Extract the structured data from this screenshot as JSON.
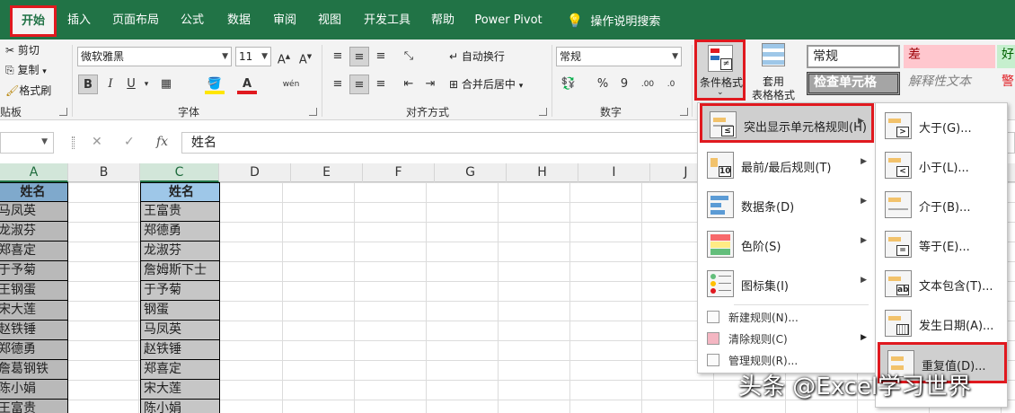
{
  "tabs": [
    "开始",
    "插入",
    "页面布局",
    "公式",
    "数据",
    "审阅",
    "视图",
    "开发工具",
    "帮助",
    "Power Pivot",
    "操作说明搜索"
  ],
  "clipboard": {
    "cut": "剪切",
    "copy": "复制",
    "format_painter": "格式刷",
    "group": "贴板"
  },
  "font": {
    "name": "微软雅黑",
    "size": "11",
    "group": "字体",
    "bold": "B",
    "italic": "I",
    "underline": "U",
    "phonetic": "wén"
  },
  "alignment": {
    "wrap": "自动换行",
    "merge": "合并后居中",
    "group": "对齐方式"
  },
  "number": {
    "format": "常规",
    "group": "数字",
    "percent": "%",
    "comma": "9"
  },
  "styles": {
    "conditional_format": "条件格式",
    "table_format_1": "套用",
    "table_format_2": "表格格式",
    "normal": "常规",
    "bad": "差",
    "good": "好",
    "check_cell": "检查单元格",
    "explanatory": "解释性文本",
    "warning": "警"
  },
  "formula_bar": {
    "fx": "fx",
    "cancel": "✕",
    "enter": "✓",
    "content": "姓名"
  },
  "columns": [
    "A",
    "B",
    "C",
    "D",
    "E",
    "F",
    "G",
    "H",
    "I",
    "J"
  ],
  "col_a": [
    "姓名",
    "马凤英",
    "龙淑芬",
    "郑喜定",
    "于予菊",
    "王钢蛋",
    "宋大莲",
    "赵铁锤",
    "郑德勇",
    "詹葛钢铁",
    "陈小娟",
    "王富贵"
  ],
  "col_c": [
    "姓名",
    "王富贵",
    "郑德勇",
    "龙淑芬",
    "詹姆斯下士",
    "于予菊",
    "钢蛋",
    "马凤英",
    "赵铁锤",
    "郑喜定",
    "宋大莲",
    "陈小娟"
  ],
  "menu": {
    "highlight_rules": "突出显示单元格规则(H)",
    "top_bottom": "最前/最后规则(T)",
    "data_bars": "数据条(D)",
    "color_scales": "色阶(S)",
    "icon_sets": "图标集(I)",
    "new_rule": "新建规则(N)...",
    "clear_rules": "清除规则(C)",
    "manage_rules": "管理规则(R)..."
  },
  "submenu": {
    "greater": "大于(G)...",
    "less": "小于(L)...",
    "between": "介于(B)...",
    "equal": "等于(E)...",
    "text_contains": "文本包含(T)...",
    "date_occurring": "发生日期(A)...",
    "duplicate": "重复值(D)..."
  },
  "watermark": "头条 @Excel学习世界"
}
